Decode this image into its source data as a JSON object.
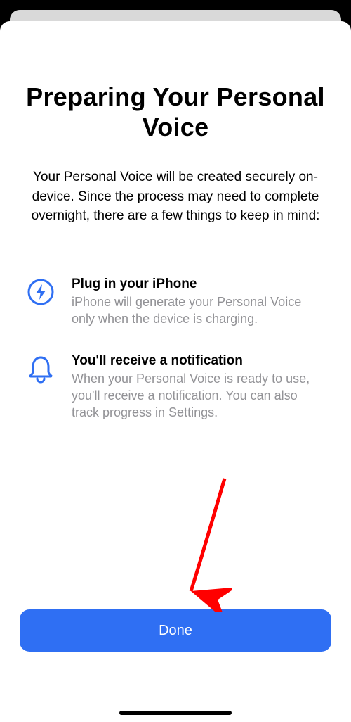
{
  "title": "Preparing Your Personal Voice",
  "subtitle": "Your Personal Voice will be created securely on-device. Since the process may need to complete overnight, there are a few things to keep in mind:",
  "items": [
    {
      "icon": "lightning-icon",
      "title": "Plug in your iPhone",
      "desc": "iPhone will generate your Personal Voice only when the device is charging."
    },
    {
      "icon": "bell-icon",
      "title": "You'll receive a notification",
      "desc": "When your Personal Voice is ready to use, you'll receive a notification. You can also track progress in Settings."
    }
  ],
  "button": {
    "done_label": "Done"
  },
  "colors": {
    "accent": "#2f6ff3",
    "arrow": "#ff0000"
  }
}
